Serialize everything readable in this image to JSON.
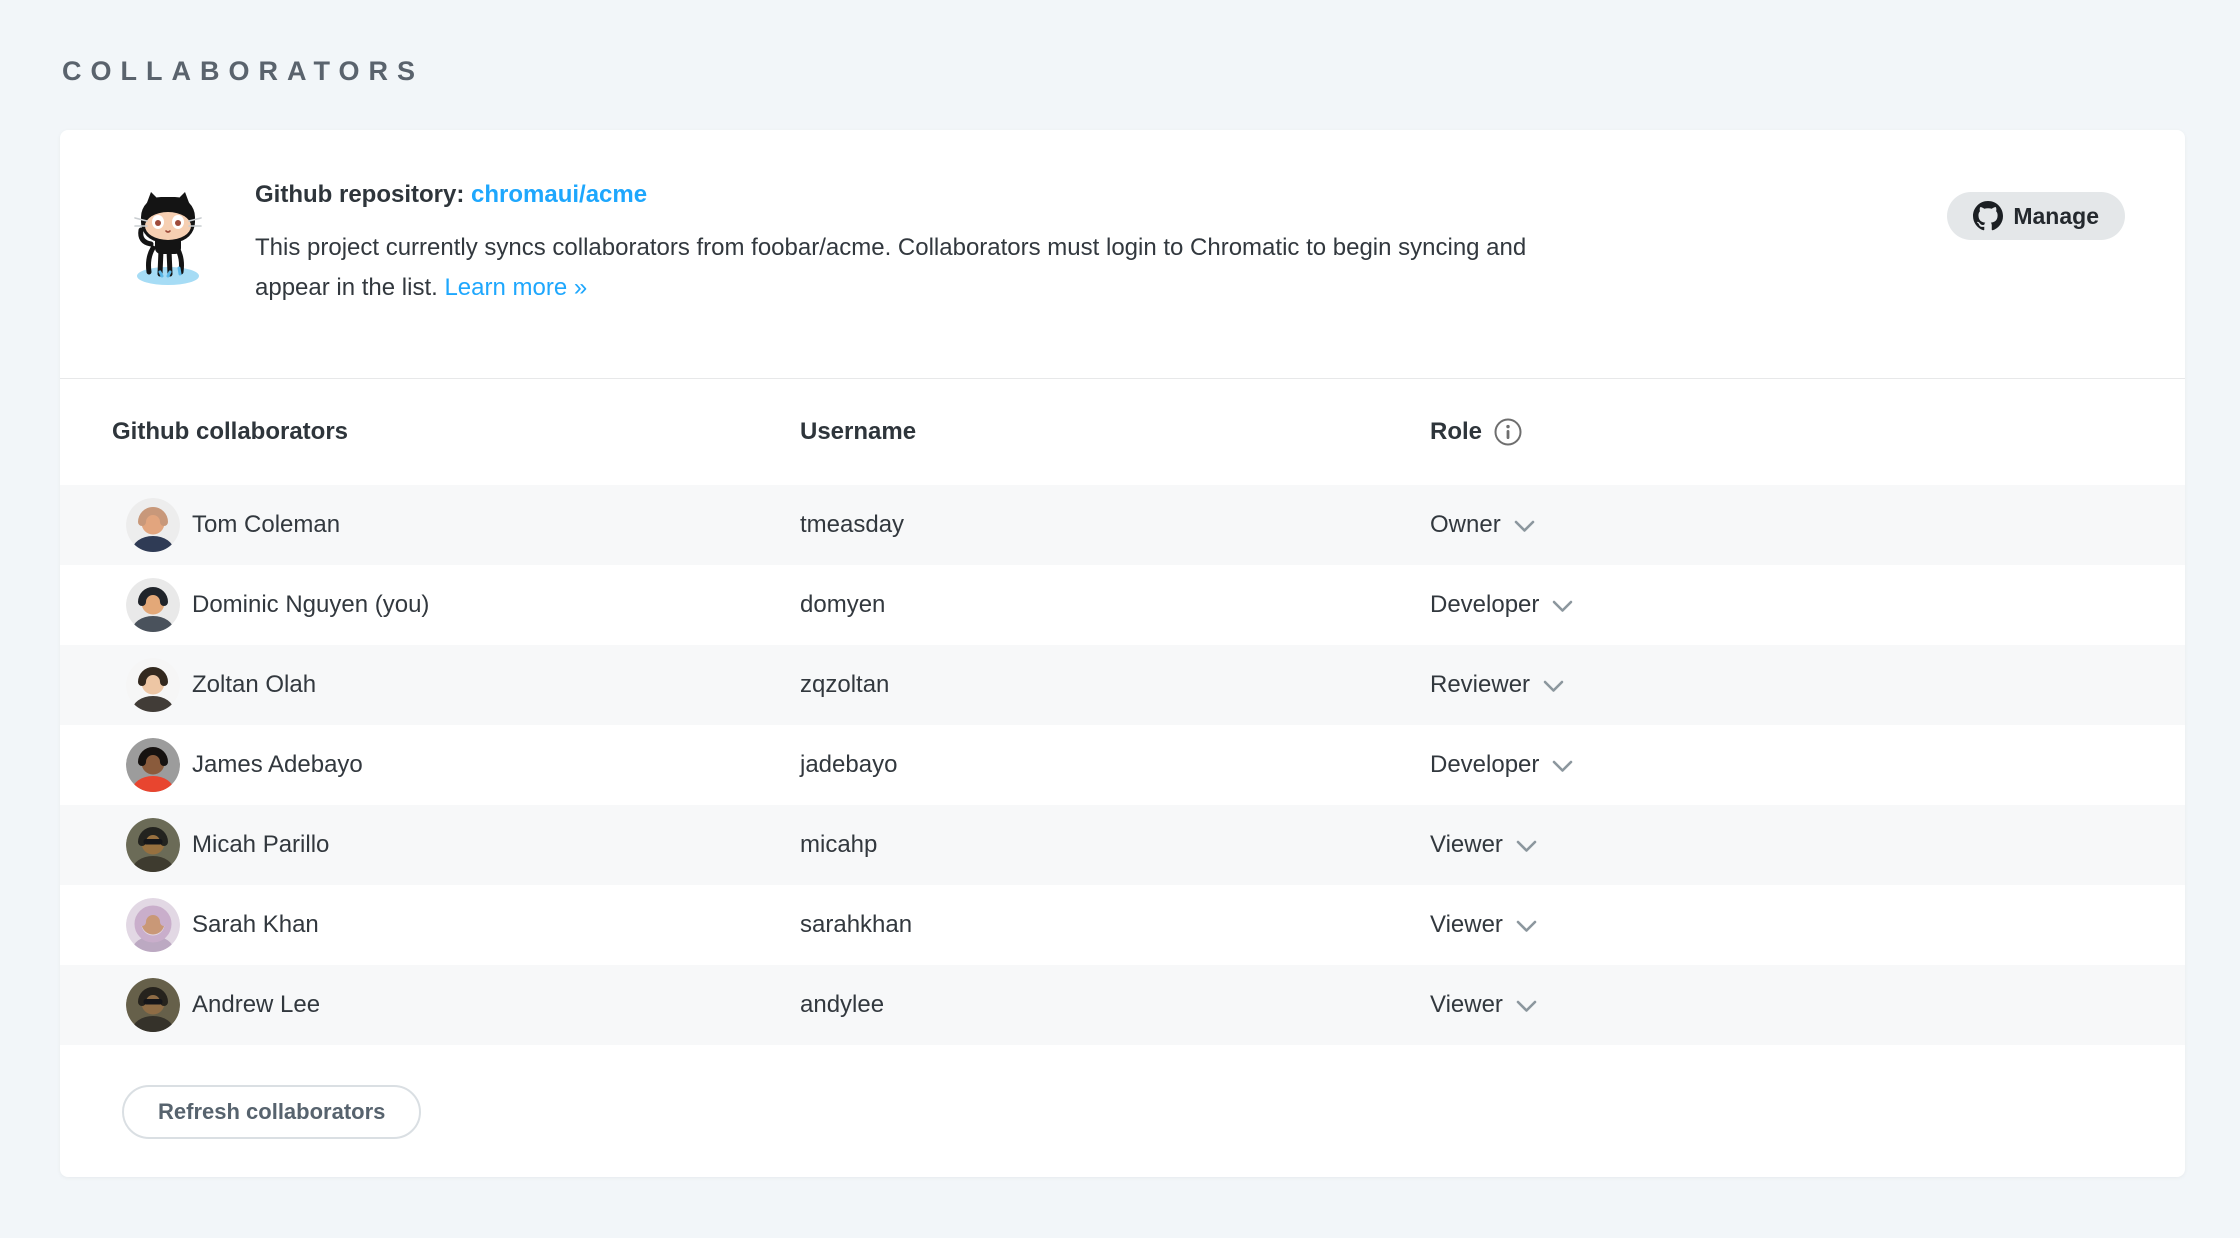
{
  "page": {
    "heading": "COLLABORATORS"
  },
  "colors": {
    "page_bg": "#F2F6F9",
    "card_bg": "#FFFFFF",
    "link_blue": "#1EA7FD",
    "stripe_gray": "#F7F8F9",
    "heading_gray": "#5A636D",
    "text_dark": "#2E353B"
  },
  "repo_section": {
    "title_label": "Github repository:",
    "repo_link": "chromaui/acme",
    "description": "This project currently syncs collaborators from foobar/acme. Collaborators must login to Chromatic to begin syncing and appear in the list.",
    "learn_more_label": "Learn more »",
    "manage_button_label": "Manage"
  },
  "table": {
    "headers": {
      "collaborators": "Github collaborators",
      "username": "Username",
      "role": "Role"
    },
    "rows": [
      {
        "name": "Tom Coleman",
        "username": "tmeasday",
        "role": "Owner",
        "avatar": {
          "bg": "#EDEDED",
          "skin": "#E2A57E",
          "hair": "#C8987A",
          "shirt": "#2F3B55",
          "accessory": "none"
        }
      },
      {
        "name": "Dominic Nguyen (you)",
        "username": "domyen",
        "role": "Developer",
        "avatar": {
          "bg": "#E9E9E9",
          "skin": "#E3A878",
          "hair": "#20242A",
          "shirt": "#4A525C",
          "accessory": "none"
        }
      },
      {
        "name": "Zoltan Olah",
        "username": "zqzoltan",
        "role": "Reviewer",
        "avatar": {
          "bg": "#F6F6F6",
          "skin": "#EDC6A4",
          "hair": "#33291F",
          "shirt": "#413C37",
          "accessory": "none"
        }
      },
      {
        "name": "James Adebayo",
        "username": "jadebayo",
        "role": "Developer",
        "avatar": {
          "bg": "#9C9C9C",
          "skin": "#8A5B3C",
          "hair": "#161210",
          "shirt": "#E8452F",
          "accessory": "none"
        }
      },
      {
        "name": "Micah Parillo",
        "username": "micahp",
        "role": "Viewer",
        "avatar": {
          "bg": "#6B6B57",
          "skin": "#97703F",
          "hair": "#23231F",
          "shirt": "#3E3B2F",
          "accessory": "sunglasses"
        }
      },
      {
        "name": "Sarah Khan",
        "username": "sarahkhan",
        "role": "Viewer",
        "avatar": {
          "bg": "#E2D8E4",
          "skin": "#C99877",
          "hair": "#C9AECB",
          "shirt": "#BCA9C2",
          "accessory": "scarf"
        }
      },
      {
        "name": "Andrew Lee",
        "username": "andylee",
        "role": "Viewer",
        "avatar": {
          "bg": "#66604A",
          "skin": "#8E6C45",
          "hair": "#26231D",
          "shirt": "#35322A",
          "accessory": "sunglasses"
        }
      }
    ]
  },
  "footer": {
    "refresh_button_label": "Refresh collaborators"
  }
}
